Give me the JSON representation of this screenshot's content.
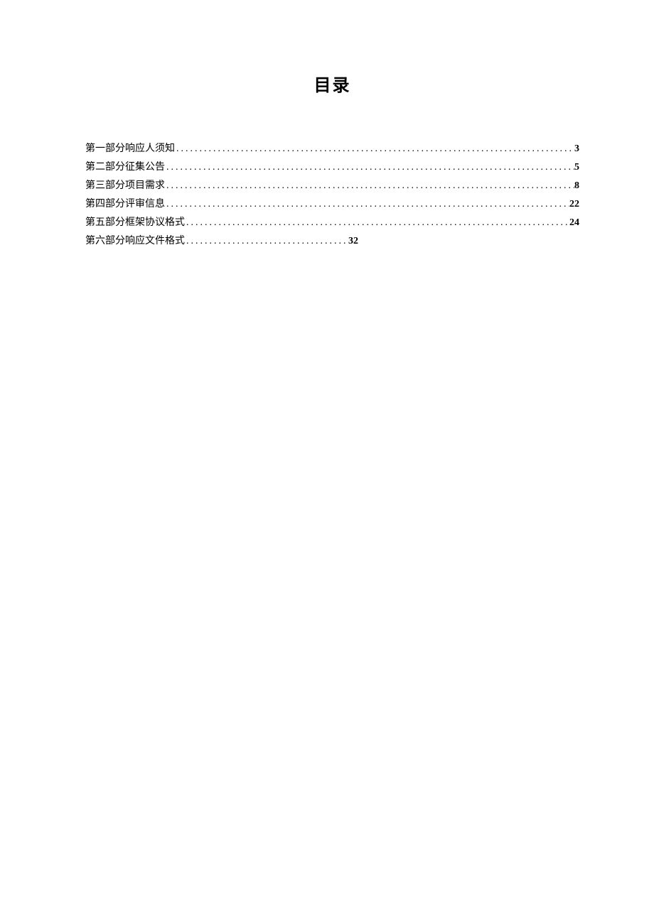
{
  "title": "目录",
  "toc": {
    "leader": "................................................................................................................................................",
    "items": [
      {
        "label": "第一部分响应人须知",
        "page": "3",
        "short": false
      },
      {
        "label": "第二部分征集公告",
        "page": "5",
        "short": false
      },
      {
        "label": "第三部分项目需求",
        "page": "8",
        "short": false
      },
      {
        "label": "第四部分评审信息",
        "page": "22",
        "short": false
      },
      {
        "label": "第五部分框架协议格式",
        "page": "24",
        "short": false
      },
      {
        "label": "第六部分响应文件格式",
        "page": "32",
        "short": true
      }
    ]
  }
}
